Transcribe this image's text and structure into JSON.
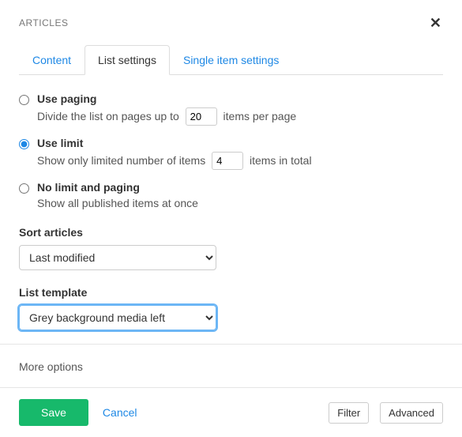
{
  "header": {
    "title": "ARTICLES"
  },
  "tabs": {
    "content": "Content",
    "list_settings": "List settings",
    "single_item": "Single item settings",
    "active": "list_settings"
  },
  "paging": {
    "use_paging_label": "Use paging",
    "use_paging_desc_pre": "Divide the list on pages up to ",
    "use_paging_value": "20",
    "use_paging_desc_post": " items per page",
    "use_limit_label": "Use limit",
    "use_limit_desc_pre": "Show only limited number of items ",
    "use_limit_value": "4",
    "use_limit_desc_post": " items in total",
    "no_limit_label": "No limit and paging",
    "no_limit_desc": "Show all published items at once",
    "selected": "use_limit"
  },
  "sort": {
    "label": "Sort articles",
    "value": "Last modified"
  },
  "template": {
    "label": "List template",
    "value": "Grey background media left"
  },
  "more": {
    "label": "More options"
  },
  "footer": {
    "save": "Save",
    "cancel": "Cancel",
    "filter": "Filter",
    "advanced": "Advanced"
  }
}
